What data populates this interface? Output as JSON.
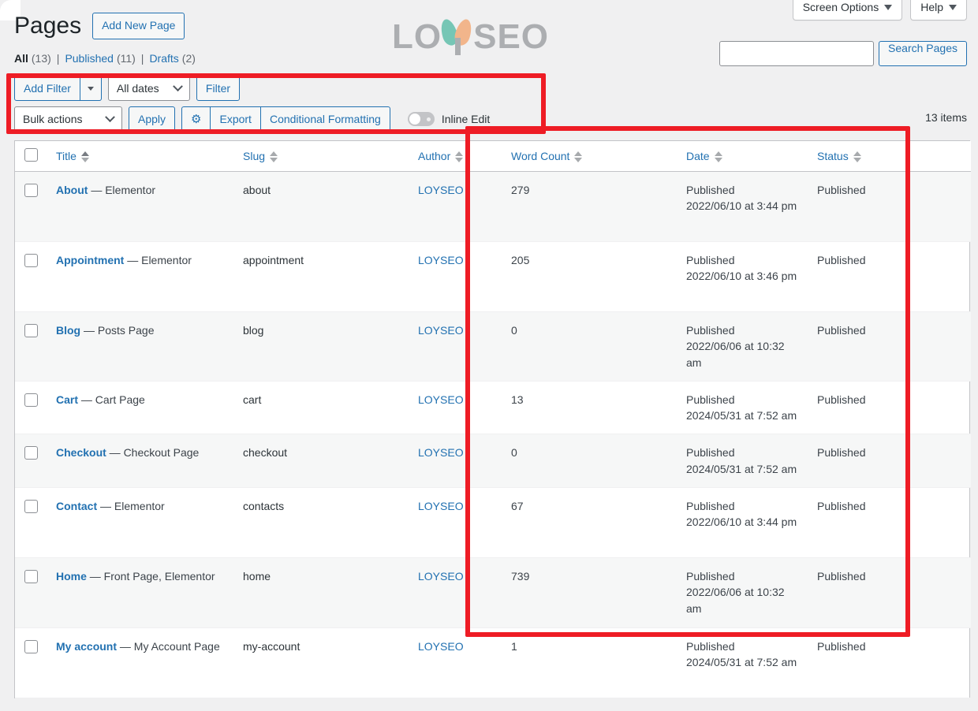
{
  "screen_meta": {
    "screen_options_label": "Screen Options",
    "help_label": "Help",
    "caret_icon": "chevron-down-icon"
  },
  "header": {
    "title": "Pages",
    "add_new_label": "Add New Page"
  },
  "logo": {
    "text_before": "LO",
    "text_after": "SEO",
    "petal_left_color": "#6cc3b0",
    "petal_right_color": "#f3b183",
    "text_color": "#a7a9ac"
  },
  "search": {
    "value": "",
    "placeholder": "",
    "button_label": "Search Pages"
  },
  "views": {
    "items": [
      {
        "label": "All",
        "count": "(13)",
        "current": true
      },
      {
        "label": "Published",
        "count": "(11)",
        "current": false
      },
      {
        "label": "Drafts",
        "count": "(2)",
        "current": false
      }
    ],
    "separator": "|"
  },
  "toolbar": {
    "add_filter_label": "Add Filter",
    "add_filter_caret": "caret-down-icon",
    "all_dates_label": "All dates",
    "filter_label": "Filter",
    "bulk_actions_label": "Bulk actions",
    "apply_label": "Apply",
    "gear_icon": "gear-icon",
    "gear_glyph": "⚙",
    "export_label": "Export",
    "conditional_formatting_label": "Conditional Formatting",
    "inline_edit_label": "Inline Edit",
    "inline_edit_state": "off"
  },
  "items_count": "13 items",
  "table": {
    "columns": [
      {
        "key": "cb",
        "label": "",
        "sortable": false
      },
      {
        "key": "title",
        "label": "Title",
        "sortable": true,
        "sorted": "asc"
      },
      {
        "key": "slug",
        "label": "Slug",
        "sortable": true,
        "sorted": "none"
      },
      {
        "key": "author",
        "label": "Author",
        "sortable": true,
        "sorted": "none"
      },
      {
        "key": "word_count",
        "label": "Word Count",
        "sortable": true,
        "sorted": "none"
      },
      {
        "key": "date",
        "label": "Date",
        "sortable": true,
        "sorted": "none"
      },
      {
        "key": "status",
        "label": "Status",
        "sortable": true,
        "sorted": "none"
      },
      {
        "key": "spacer",
        "label": "",
        "sortable": false
      }
    ],
    "rows": [
      {
        "title": "About",
        "post_state": " — Elementor",
        "slug": "about",
        "author": "LOYSEO",
        "word_count": "279",
        "date_label": "Published",
        "date_value": "2022/06/10 at 3:44 pm",
        "status": "Published"
      },
      {
        "title": "Appointment",
        "post_state": " — Elementor",
        "slug": "appointment",
        "author": "LOYSEO",
        "word_count": "205",
        "date_label": "Published",
        "date_value": "2022/06/10 at 3:46 pm",
        "status": "Published"
      },
      {
        "title": "Blog",
        "post_state": " — Posts Page",
        "slug": "blog",
        "author": "LOYSEO",
        "word_count": "0",
        "date_label": "Published",
        "date_value": "2022/06/06 at 10:32 am",
        "status": "Published"
      },
      {
        "title": "Cart",
        "post_state": " — Cart Page",
        "slug": "cart",
        "author": "LOYSEO",
        "word_count": "13",
        "date_label": "Published",
        "date_value": "2024/05/31 at 7:52 am",
        "status": "Published"
      },
      {
        "title": "Checkout",
        "post_state": " — Checkout Page",
        "slug": "checkout",
        "author": "LOYSEO",
        "word_count": "0",
        "date_label": "Published",
        "date_value": "2024/05/31 at 7:52 am",
        "status": "Published"
      },
      {
        "title": "Contact",
        "post_state": " — Elementor",
        "slug": "contacts",
        "author": "LOYSEO",
        "word_count": "67",
        "date_label": "Published",
        "date_value": "2022/06/10 at 3:44 pm",
        "status": "Published"
      },
      {
        "title": "Home",
        "post_state": " — Front Page, Elementor",
        "slug": "home",
        "author": "LOYSEO",
        "word_count": "739",
        "date_label": "Published",
        "date_value": "2022/06/06 at 10:32 am",
        "status": "Published"
      },
      {
        "title": "My account",
        "post_state": " — My Account Page",
        "slug": "my-account",
        "author": "LOYSEO",
        "word_count": "1",
        "date_label": "Published",
        "date_value": "2024/05/31 at 7:52 am",
        "status": "Published"
      }
    ]
  },
  "annotations": {
    "color": "#ee1c25",
    "boxes": [
      {
        "name": "toolbar-highlight"
      },
      {
        "name": "columns-highlight"
      }
    ]
  }
}
